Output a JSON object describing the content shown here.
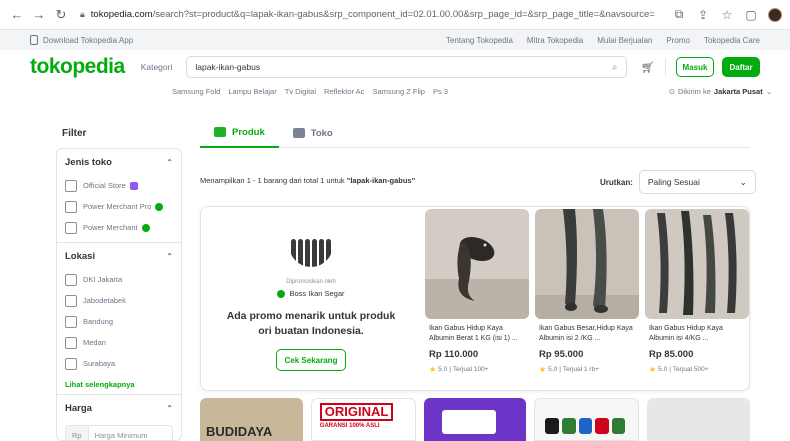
{
  "browser": {
    "host": "tokopedia.com",
    "path": "/search?st=product&q=lapak-ikan-gabus&srp_component_id=02.01.00.00&srp_page_id=&srp_page_title=&navsource="
  },
  "topbar": {
    "download": "Download Tokopedia App",
    "links": [
      "Tentang Tokopedia",
      "Mitra Tokopedia",
      "Mulai Berjualan",
      "Promo",
      "Tokopedia Care"
    ]
  },
  "header": {
    "logo": "tokopedia",
    "kategori": "Kategori",
    "search_value": "lapak-ikan-gabus",
    "masuk": "Masuk",
    "daftar": "Daftar"
  },
  "keywords": [
    "Samsung Fold",
    "Lampu Belajar",
    "Tv Digital",
    "Reflektor Ac",
    "Samsung Z Flip",
    "Ps 3"
  ],
  "shipping": {
    "label": "Dikirim ke",
    "location": "Jakarta Pusat"
  },
  "filter": {
    "title": "Filter",
    "jenis_toko": {
      "title": "Jenis toko",
      "options": [
        "Official Store",
        "Power Merchant Pro",
        "Power Merchant"
      ]
    },
    "lokasi": {
      "title": "Lokasi",
      "options": [
        "DKI Jakarta",
        "Jabodetabek",
        "Bandung",
        "Medan",
        "Surabaya"
      ],
      "see_all": "Lihat selengkapnya"
    },
    "harga": {
      "title": "Harga",
      "currency": "Rp",
      "placeholder": "Harga Minimum"
    }
  },
  "tabs": [
    "Produk",
    "Toko"
  ],
  "results": {
    "prefix": "Menampilkan 1 - 1 barang dari total 1 untuk",
    "query": "\"lapak-ikan-gabus\""
  },
  "sort": {
    "label": "Urutkan:",
    "value": "Paling Sesuai"
  },
  "promo": {
    "by": "Dipromosikan oleh",
    "shop": "Boss Ikan Segar",
    "headline": "Ada promo menarik untuk produk ori buatan Indonesia.",
    "cta": "Cek Sekarang"
  },
  "products": [
    {
      "title": "Ikan Gabus Hidup Kaya Albumin Berat 1 KG (isi 1) ...",
      "price": "Rp 110.000",
      "rating": "5.0",
      "sold": "Terjual 100+"
    },
    {
      "title": "Ikan Gabus Besar,Hidup Kaya Albumin isi 2 /KG ...",
      "price": "Rp 95.000",
      "rating": "5.0",
      "sold": "Terjual 1 rb+"
    },
    {
      "title": "Ikan Gabus Hidup Kaya Albumin isi 4/KG ...",
      "price": "Rp 85.000",
      "rating": "5.0",
      "sold": "Terjual 500+"
    }
  ],
  "banners": {
    "b1": "BUDIDAYA",
    "b2": "ORIGINAL",
    "b2_sub": "GARANSI 100% ASLI"
  },
  "colors": {
    "brand": "#03ac0e",
    "star": "#ffc400"
  }
}
